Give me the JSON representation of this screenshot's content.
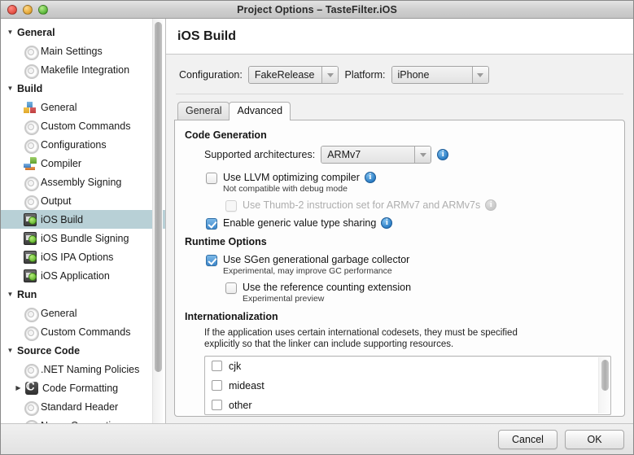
{
  "window": {
    "title": "Project Options – TasteFilter.iOS",
    "controls": [
      "close",
      "minimize",
      "zoom"
    ]
  },
  "sidebar": {
    "items": [
      {
        "label": "General",
        "type": "group",
        "icon": "disclosure-triangle-down",
        "expanded": true
      },
      {
        "label": "Main Settings",
        "type": "child",
        "icon": "gear-icon"
      },
      {
        "label": "Makefile Integration",
        "type": "child",
        "icon": "gear-icon"
      },
      {
        "label": "Build",
        "type": "group",
        "icon": "disclosure-triangle-down",
        "expanded": true
      },
      {
        "label": "General",
        "type": "child",
        "icon": "blocks-icon"
      },
      {
        "label": "Custom Commands",
        "type": "child",
        "icon": "gear-icon"
      },
      {
        "label": "Configurations",
        "type": "child",
        "icon": "gear-icon"
      },
      {
        "label": "Compiler",
        "type": "child",
        "icon": "compiler-icon"
      },
      {
        "label": "Assembly Signing",
        "type": "child",
        "icon": "gear-icon"
      },
      {
        "label": "Output",
        "type": "child",
        "icon": "gear-icon"
      },
      {
        "label": "iOS Build",
        "type": "child",
        "icon": "ios-device-icon",
        "selected": true
      },
      {
        "label": "iOS Bundle Signing",
        "type": "child",
        "icon": "ios-device-icon"
      },
      {
        "label": "iOS IPA Options",
        "type": "child",
        "icon": "ios-device-icon"
      },
      {
        "label": "iOS Application",
        "type": "child",
        "icon": "ios-device-icon"
      },
      {
        "label": "Run",
        "type": "group",
        "icon": "disclosure-triangle-down",
        "expanded": true
      },
      {
        "label": "General",
        "type": "child",
        "icon": "gear-icon"
      },
      {
        "label": "Custom Commands",
        "type": "child",
        "icon": "gear-icon"
      },
      {
        "label": "Source Code",
        "type": "group",
        "icon": "disclosure-triangle-down",
        "expanded": true
      },
      {
        "label": ".NET Naming Policies",
        "type": "child",
        "icon": "gear-icon"
      },
      {
        "label": "Code Formatting",
        "type": "child-arrow",
        "icon": "code-formatting-icon",
        "expanded": false
      },
      {
        "label": "Standard Header",
        "type": "child",
        "icon": "gear-icon"
      },
      {
        "label": "Name Conventions",
        "type": "child",
        "icon": "gear-icon"
      }
    ]
  },
  "main": {
    "title": "iOS Build",
    "configuration_label": "Configuration:",
    "configuration_value": "FakeRelease",
    "platform_label": "Platform:",
    "platform_value": "iPhone",
    "tabs": [
      {
        "label": "General",
        "active": false
      },
      {
        "label": "Advanced",
        "active": true
      }
    ],
    "code_generation": {
      "heading": "Code Generation",
      "architectures_label": "Supported architectures:",
      "architectures_value": "ARMv7",
      "llvm": {
        "label": "Use LLVM optimizing compiler",
        "sublabel": "Not compatible with debug mode",
        "checked": false,
        "disabled": false
      },
      "thumb2": {
        "label": "Use Thumb-2 instruction set for ARMv7 and ARMv7s",
        "checked": false,
        "disabled": true
      },
      "generic_sharing": {
        "label": "Enable generic value type sharing",
        "checked": true,
        "disabled": false
      }
    },
    "runtime_options": {
      "heading": "Runtime Options",
      "sgen": {
        "label": "Use SGen generational garbage collector",
        "sublabel": "Experimental, may improve GC performance",
        "checked": true
      },
      "refcount": {
        "label": "Use the reference counting extension",
        "sublabel": "Experimental preview",
        "checked": false
      }
    },
    "internationalization": {
      "heading": "Internationalization",
      "description": "If the application uses certain international codesets, they must be specified explicitly so that the linker can include supporting resources.",
      "items": [
        {
          "label": "cjk",
          "checked": false
        },
        {
          "label": "mideast",
          "checked": false
        },
        {
          "label": "other",
          "checked": false
        }
      ]
    }
  },
  "footer": {
    "cancel_label": "Cancel",
    "ok_label": "OK"
  },
  "colors": {
    "selection": "#b8d0d6",
    "info_icon": "#2b7dc4",
    "checkbox_checked": "#3e87ca",
    "titlebar": "#cfcfcf"
  }
}
